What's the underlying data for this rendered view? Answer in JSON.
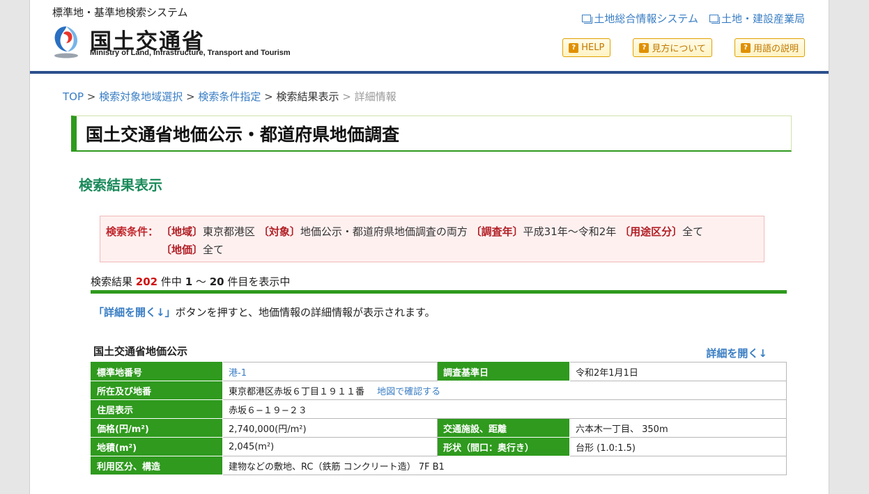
{
  "header": {
    "site_name": "標準地・基準地検索システム",
    "logo_jp": "国土交通省",
    "logo_en": "Ministry of Land, Infrastructure, Transport and Tourism",
    "top_links": [
      "土地総合情報システム",
      "土地・建設産業局"
    ],
    "help_buttons": [
      "HELP",
      "見方について",
      "用語の説明"
    ]
  },
  "breadcrumb": {
    "items": [
      "TOP",
      "検索対象地域選択",
      "検索条件指定",
      "検索結果表示",
      "詳細情報"
    ],
    "separator": ">"
  },
  "page_title": "国土交通省地価公示・都道府県地価調査",
  "section_title": "検索結果表示",
  "conditions": {
    "label": "検索条件：",
    "region_key": "〔地域〕",
    "region_val": "東京都港区",
    "target_key": "〔対象〕",
    "target_val": "地価公示・都道府県地価調査の両方",
    "year_key": "〔調査年〕",
    "year_val": "平成31年～令和2年",
    "use_key": "〔用途区分〕",
    "use_val": "全て",
    "price_key": "〔地価〕",
    "price_val": "全て"
  },
  "result": {
    "prefix": "検索結果",
    "total": "202",
    "mid": "件中",
    "from": "1",
    "tilde": "～",
    "to": "20",
    "suffix": "件目を表示中"
  },
  "instruction": {
    "button_ref": "「詳細を開く↓」",
    "text": "ボタンを押すと、地価情報の詳細情報が表示されます。"
  },
  "table_heading": "国土交通省地価公示",
  "detail_link": "詳細を開く↓",
  "table": {
    "std_no_label": "標準地番号",
    "std_no": "港-1",
    "base_date_label": "調査基準日",
    "base_date": "令和2年1月1日",
    "location_label": "所在及び地番",
    "location": "東京都港区赤坂６丁目１９１１番",
    "map_link": "地図で確認する",
    "address_label": "住居表示",
    "address": "赤坂６−１９−２３",
    "price_label": "価格(円/m²)",
    "price": "2,740,000(円/m²)",
    "transport_label": "交通施設、距離",
    "transport": "六本木一丁目、 350m",
    "area_label": "地積(m²)",
    "area": "2,045(m²)",
    "shape_label": "形状（間口：奥行き）",
    "shape": "台形 (1.0:1.5)",
    "usage_label": "利用区分、構造",
    "usage": "建物などの敷地、RC（鉄筋 コンクリート造） 7F B1"
  },
  "colors": {
    "accent_green": "#2f9a1e",
    "header_blue": "#2c4f8c",
    "link_blue": "#3a7ec4",
    "alert_red": "#c0272d"
  }
}
